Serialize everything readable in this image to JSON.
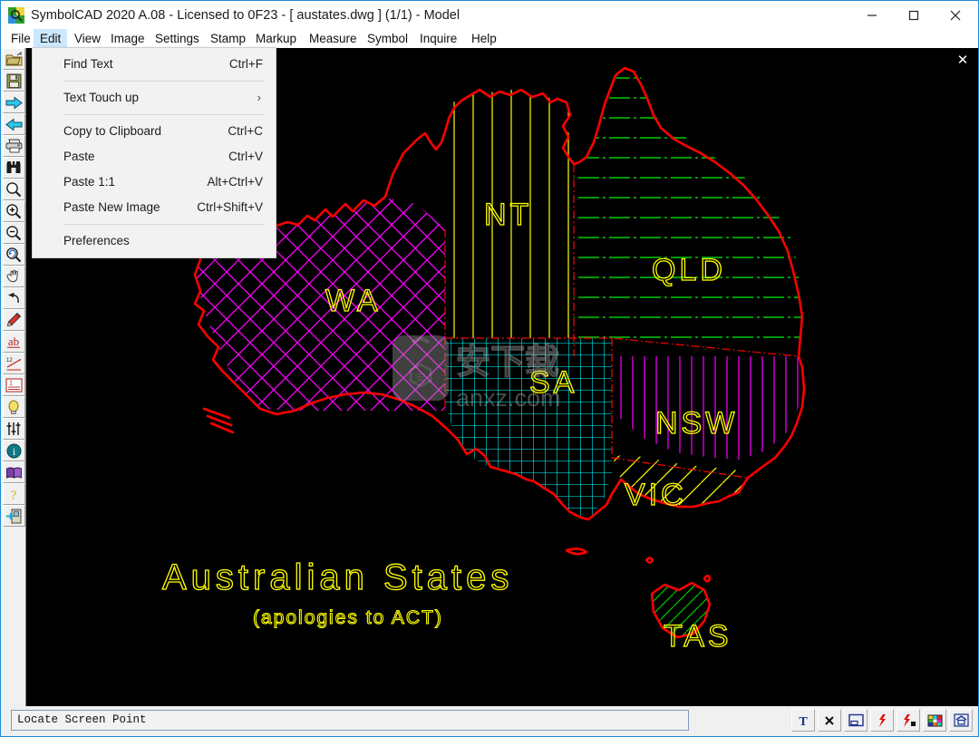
{
  "window": {
    "title": "SymbolCAD 2020 A.08 - Licensed to 0F23  -  [ austates.dwg ] (1/1)  -  Model",
    "icon_name": "app-icon",
    "minimize_label": "—",
    "maximize_label": "□",
    "close_label": "✕"
  },
  "menubar": {
    "items": [
      {
        "label": "File",
        "active": false
      },
      {
        "label": "Edit",
        "active": true
      },
      {
        "label": "View",
        "active": false
      },
      {
        "label": "Image",
        "active": false
      },
      {
        "label": "Settings",
        "active": false
      },
      {
        "label": "Stamp",
        "active": false
      },
      {
        "label": "Markup",
        "active": false
      },
      {
        "label": "Measure",
        "active": false
      },
      {
        "label": "Symbol",
        "active": false
      },
      {
        "label": "Inquire",
        "active": false
      },
      {
        "label": "Help",
        "active": false
      }
    ]
  },
  "edit_menu": {
    "items": [
      {
        "label": "Find Text",
        "accel": "Ctrl+F",
        "submenu": false
      },
      {
        "separator": true
      },
      {
        "label": "Text Touch up",
        "accel": "",
        "submenu": true
      },
      {
        "separator": true
      },
      {
        "label": "Copy to Clipboard",
        "accel": "Ctrl+C",
        "submenu": false
      },
      {
        "label": "Paste",
        "accel": "Ctrl+V",
        "submenu": false
      },
      {
        "label": "Paste 1:1",
        "accel": "Alt+Ctrl+V",
        "submenu": false
      },
      {
        "label": "Paste New Image",
        "accel": "Ctrl+Shift+V",
        "submenu": false
      },
      {
        "separator": true
      },
      {
        "label": "Preferences",
        "accel": "",
        "submenu": false
      }
    ]
  },
  "toolbar": {
    "items": [
      {
        "name": "open-folder-icon",
        "tip": "Open"
      },
      {
        "name": "save-disk-icon",
        "tip": "Save"
      },
      {
        "name": "arrow-right-icon",
        "tip": "Next"
      },
      {
        "name": "arrow-left-icon",
        "tip": "Previous"
      },
      {
        "name": "printer-icon",
        "tip": "Print"
      },
      {
        "name": "binoculars-icon",
        "tip": "Find"
      },
      {
        "name": "magnifier-icon",
        "tip": "Zoom"
      },
      {
        "name": "zoom-in-icon",
        "tip": "Zoom In"
      },
      {
        "name": "zoom-out-icon",
        "tip": "Zoom Out"
      },
      {
        "name": "zoom-previous-icon",
        "tip": "Zoom Previous"
      },
      {
        "name": "pan-hand-icon",
        "tip": "Pan"
      },
      {
        "name": "undo-arrow-icon",
        "tip": "Undo"
      },
      {
        "name": "pencil-icon",
        "tip": "Draw"
      },
      {
        "name": "ab-text-icon",
        "tip": "Text"
      },
      {
        "name": "dimension-icon",
        "tip": "Dimension"
      },
      {
        "name": "line-number-icon",
        "tip": "Number"
      },
      {
        "name": "lightbulb-icon",
        "tip": "Layers"
      },
      {
        "name": "sliders-icon",
        "tip": "Adjust"
      },
      {
        "name": "info-icon",
        "tip": "Info"
      },
      {
        "name": "book-icon",
        "tip": "Manual"
      },
      {
        "name": "question-help-icon",
        "tip": "Help"
      },
      {
        "name": "exit-door-icon",
        "tip": "Exit"
      }
    ]
  },
  "canvas": {
    "close_label": "✕",
    "background": "#000000",
    "drawing": {
      "title": "Australian States",
      "subtitle": "(apologies to ACT)",
      "title_color": "#ffff00",
      "outline_color": "#ff0000",
      "states": [
        {
          "code": "WA",
          "label": "WA",
          "hatch": "cross-diagonal",
          "hatch_color": "#ff00ff",
          "label_color": "#ffff00"
        },
        {
          "code": "NT",
          "label": "NT",
          "hatch": "vertical",
          "hatch_color": "#ffff00",
          "label_color": "#ffff00"
        },
        {
          "code": "QLD",
          "label": "QLD",
          "hatch": "horizontal-dashdot",
          "hatch_color": "#00cc00",
          "label_color": "#ffff00"
        },
        {
          "code": "SA",
          "label": "SA",
          "hatch": "grid",
          "hatch_color": "#00ffff",
          "label_color": "#ffff00"
        },
        {
          "code": "NSW",
          "label": "NSW",
          "hatch": "vertical",
          "hatch_color": "#ff00ff",
          "label_color": "#ffff00"
        },
        {
          "code": "VIC",
          "label": "VIC",
          "hatch": "diagonal",
          "hatch_color": "#ffff00",
          "label_color": "#ffff00"
        },
        {
          "code": "TAS",
          "label": "TAS",
          "hatch": "diagonal",
          "hatch_color": "#00cc00",
          "label_color": "#ffff00"
        }
      ]
    },
    "watermark": {
      "text": "anxz.com",
      "cn_text": "安下载"
    }
  },
  "statusbar": {
    "message": "Locate Screen Point",
    "icons": [
      {
        "name": "text-tool-icon",
        "glyph": "T"
      },
      {
        "name": "close-x-icon",
        "glyph": "✕"
      },
      {
        "name": "window-icon",
        "glyph": ""
      },
      {
        "name": "lightning-icon",
        "glyph": ""
      },
      {
        "name": "lightning-box-icon",
        "glyph": ""
      },
      {
        "name": "color-palette-icon",
        "glyph": ""
      },
      {
        "name": "home-icon",
        "glyph": ""
      }
    ]
  }
}
